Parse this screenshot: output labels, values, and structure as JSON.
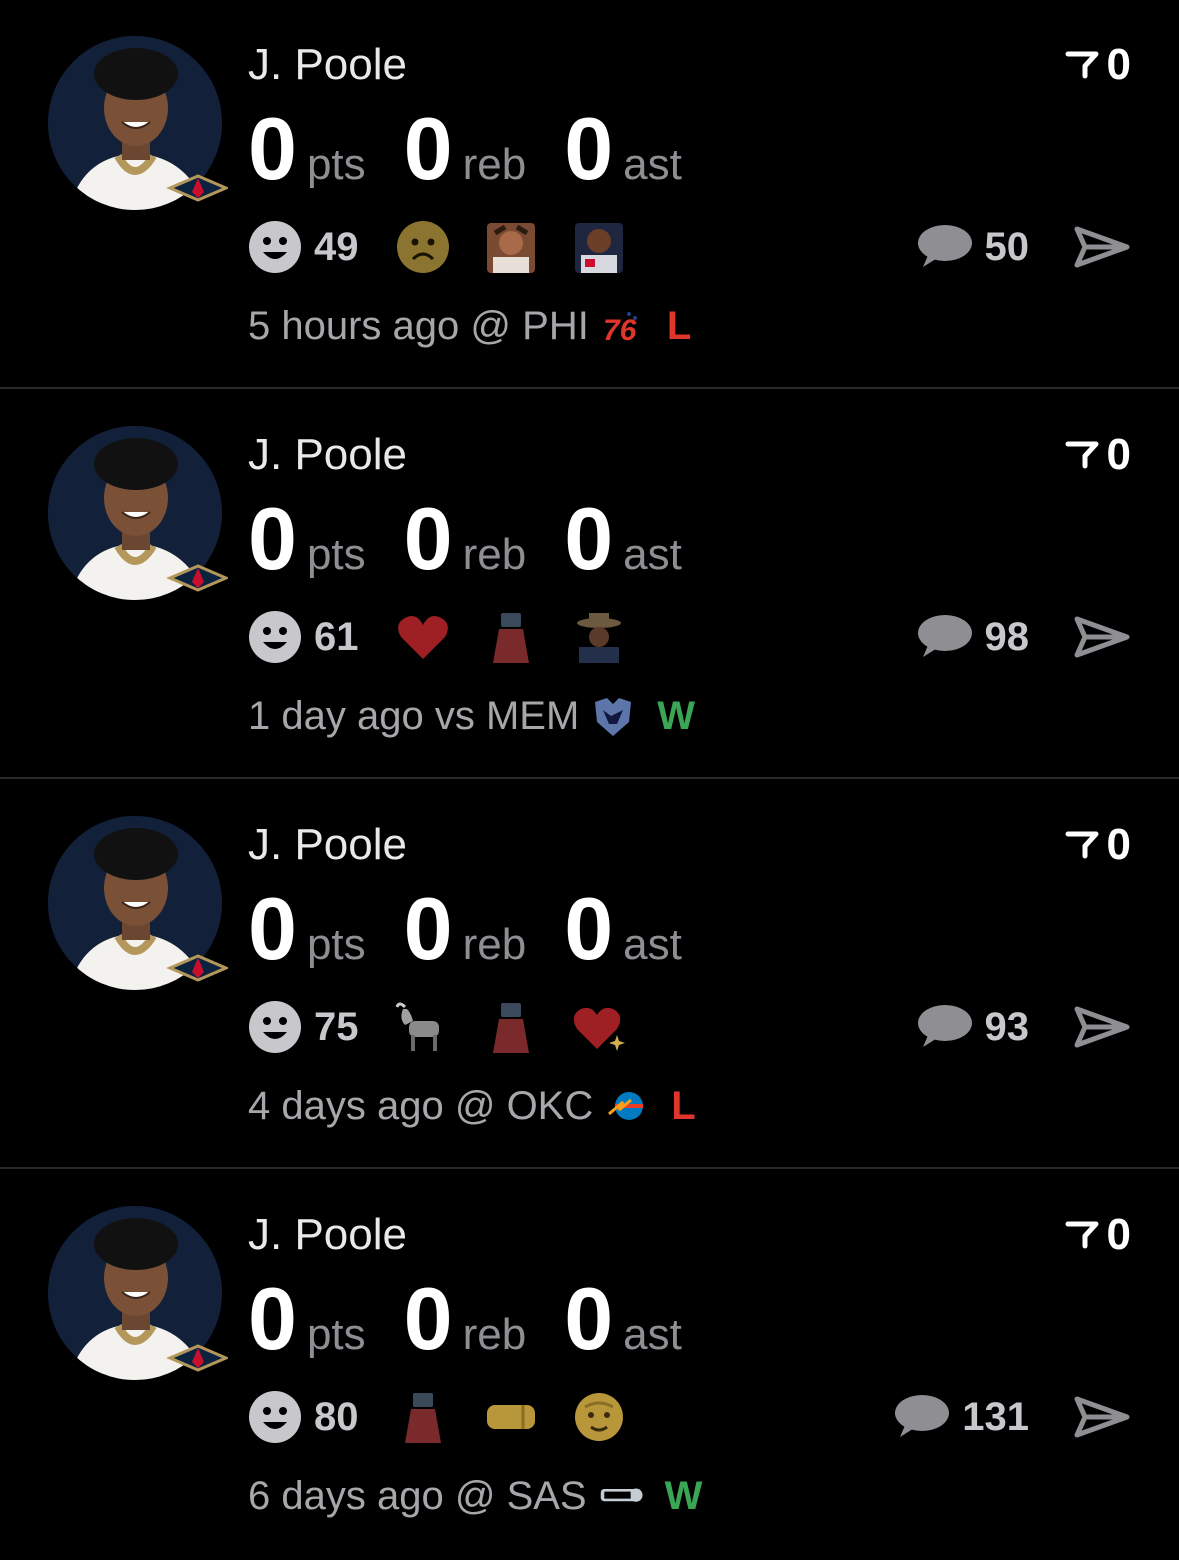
{
  "player": "J. Poole",
  "stat_units": {
    "pts": "pts",
    "reb": "reb",
    "ast": "ast"
  },
  "colors": {
    "win": "#3aa655",
    "loss": "#e0352b",
    "secondary": "#8e8e93"
  },
  "games": [
    {
      "player": "J. Poole",
      "pts": "0",
      "reb": "0",
      "ast": "0",
      "filter_count": "0",
      "reaction_count": "49",
      "reactions": [
        "frowning-face",
        "distressed-person-sticker",
        "player-sticker"
      ],
      "comment_count": "50",
      "time": "5 hours ago",
      "venue": "@",
      "opponent": "PHI",
      "opponent_logo": "76ers-logo",
      "opponent_logo_text": "76",
      "result": "L"
    },
    {
      "player": "J. Poole",
      "pts": "0",
      "reb": "0",
      "ast": "0",
      "filter_count": "0",
      "reaction_count": "61",
      "reactions": [
        "red-heart",
        "trash-can-sticker",
        "cowboy-hat-sticker"
      ],
      "comment_count": "98",
      "time": "1 day ago",
      "venue": "vs",
      "opponent": "MEM",
      "opponent_logo": "grizzlies-logo",
      "result": "W"
    },
    {
      "player": "J. Poole",
      "pts": "0",
      "reb": "0",
      "ast": "0",
      "filter_count": "0",
      "reaction_count": "75",
      "reactions": [
        "goat",
        "trash-can-sticker",
        "sparkling-heart"
      ],
      "comment_count": "93",
      "time": "4 days ago",
      "venue": "@",
      "opponent": "OKC",
      "opponent_logo": "thunder-logo",
      "result": "L"
    },
    {
      "player": "J. Poole",
      "pts": "0",
      "reb": "0",
      "ast": "0",
      "filter_count": "0",
      "reaction_count": "80",
      "reactions": [
        "trash-can-sticker",
        "fist-bump",
        "old-man-face"
      ],
      "comment_count": "131",
      "time": "6 days ago",
      "venue": "@",
      "opponent": "SAS",
      "opponent_logo": "spurs-logo",
      "result": "W"
    }
  ]
}
